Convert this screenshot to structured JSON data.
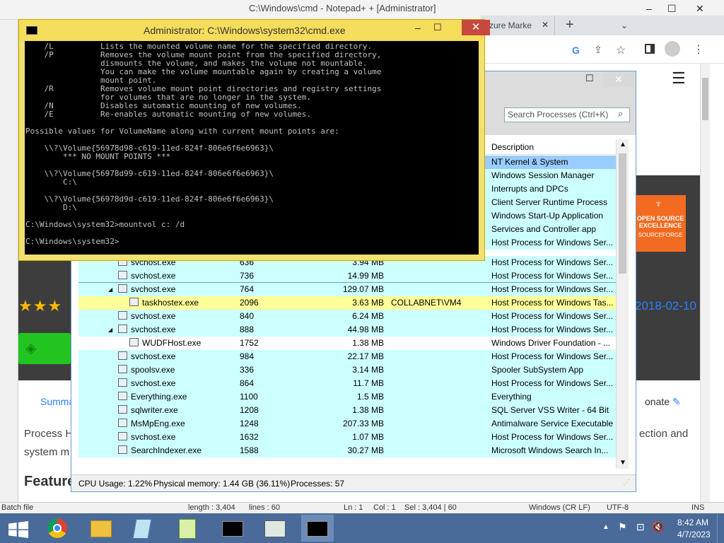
{
  "notepad": {
    "title_left": "C:\\Windows\\cmd",
    "title_mid": "- Notepad+ +",
    "title_right": "[Administrator]",
    "status": [
      "Batch file",
      "length : 3,404",
      "lines : 60",
      "Ln : 1",
      "Col : 1",
      "Sel : 3,404 | 60",
      "Windows (CR LF)",
      "UTF-8",
      "INS"
    ]
  },
  "chrome": {
    "tab_label": "Azure Marke",
    "new_tab": "+"
  },
  "webpage": {
    "badge_line1": "OPEN SOURCE",
    "badge_line2": "EXCELLENCE",
    "badge_brand": "SOURCEFORGE",
    "date": "2018-02-10",
    "stars": "★★★",
    "summary_tab": "Summa",
    "donate": "onate",
    "text_line1_left": "Process H",
    "text_line2_left": "system m",
    "text_line1_right": "ection and",
    "features_heading": "Feature"
  },
  "cmd": {
    "title": "Administrator: C:\\Windows\\system32\\cmd.exe",
    "output": "    /L          Lists the mounted volume name for the specified directory.\n    /P          Removes the volume mount point from the specified directory,\n                dismounts the volume, and makes the volume not mountable.\n                You can make the volume mountable again by creating a volume\n                mount point.\n    /R          Removes volume mount point directories and registry settings\n                for volumes that are no longer in the system.\n    /N          Disables automatic mounting of new volumes.\n    /E          Re-enables automatic mounting of new volumes.\n\nPossible values for VolumeName along with current mount points are:\n\n    \\\\?\\Volume{56978d98-c619-11ed-824f-806e6f6e6963}\\\n        *** NO MOUNT POINTS ***\n\n    \\\\?\\Volume{56978d99-c619-11ed-824f-806e6f6e6963}\\\n        C:\\\n\n    \\\\?\\Volume{56978d9d-c619-11ed-824f-806e6f6e6963}\\\n        D:\\\n\nC:\\Windows\\system32>mountvol c: /d\n\nC:\\Windows\\system32>"
  },
  "process_explorer": {
    "search_placeholder": "Search Processes (Ctrl+K)",
    "description_header": "Description",
    "top_descriptions": [
      "NT Kernel & System",
      "Windows Session Manager",
      "Interrupts and DPCs",
      "Client Server Runtime Process",
      "Windows Start-Up Application",
      "Services and Controller app",
      "Host Process for Windows Ser..."
    ],
    "rows": [
      {
        "name": "svchost.exe",
        "pid": "636",
        "mem": "3.94 MB",
        "user": "",
        "desc": "Host Process for Windows Ser...",
        "color": "#ccffff",
        "indent": 0,
        "expand": ""
      },
      {
        "name": "svchost.exe",
        "pid": "736",
        "mem": "14.99 MB",
        "user": "",
        "desc": "Host Process for Windows Ser...",
        "color": "#ccffff",
        "indent": 0,
        "expand": ""
      },
      {
        "name": "svchost.exe",
        "pid": "764",
        "mem": "129.07 MB",
        "user": "",
        "desc": "Host Process for Windows Ser...",
        "color": "#ccffff",
        "indent": 0,
        "expand": "◢",
        "selected": true
      },
      {
        "name": "taskhostex.exe",
        "pid": "2096",
        "mem": "3.63 MB",
        "user": "COLLABNET\\VM4",
        "desc": "Host Process for Windows Tas...",
        "color": "#ffff99",
        "indent": 1,
        "expand": ""
      },
      {
        "name": "svchost.exe",
        "pid": "840",
        "mem": "6.24 MB",
        "user": "",
        "desc": "Host Process for Windows Ser...",
        "color": "#ccffff",
        "indent": 0,
        "expand": ""
      },
      {
        "name": "svchost.exe",
        "pid": "888",
        "mem": "44.98 MB",
        "user": "",
        "desc": "Host Process for Windows Ser...",
        "color": "#ccffff",
        "indent": 0,
        "expand": "◢"
      },
      {
        "name": "WUDFHost.exe",
        "pid": "1752",
        "mem": "1.38 MB",
        "user": "",
        "desc": "Windows Driver Foundation - ...",
        "color": "#ffffff",
        "indent": 1,
        "expand": ""
      },
      {
        "name": "svchost.exe",
        "pid": "984",
        "mem": "22.17 MB",
        "user": "",
        "desc": "Host Process for Windows Ser...",
        "color": "#ccffff",
        "indent": 0,
        "expand": ""
      },
      {
        "name": "spoolsv.exe",
        "pid": "336",
        "mem": "3.14 MB",
        "user": "",
        "desc": "Spooler SubSystem App",
        "color": "#ccffff",
        "indent": 0,
        "expand": ""
      },
      {
        "name": "svchost.exe",
        "pid": "864",
        "mem": "11.7 MB",
        "user": "",
        "desc": "Host Process for Windows Ser...",
        "color": "#ccffff",
        "indent": 0,
        "expand": ""
      },
      {
        "name": "Everything.exe",
        "pid": "1100",
        "mem": "1.5 MB",
        "user": "",
        "desc": "Everything",
        "color": "#ccffff",
        "indent": 0,
        "expand": ""
      },
      {
        "name": "sqlwriter.exe",
        "pid": "1208",
        "mem": "1.38 MB",
        "user": "",
        "desc": "SQL Server VSS Writer - 64 Bit",
        "color": "#ccffff",
        "indent": 0,
        "expand": ""
      },
      {
        "name": "MsMpEng.exe",
        "pid": "1248",
        "mem": "207.33 MB",
        "user": "",
        "desc": "Antimalware Service Executable",
        "color": "#ccffff",
        "indent": 0,
        "expand": ""
      },
      {
        "name": "svchost.exe",
        "pid": "1632",
        "mem": "1.07 MB",
        "user": "",
        "desc": "Host Process for Windows Ser...",
        "color": "#ccffff",
        "indent": 0,
        "expand": ""
      },
      {
        "name": "SearchIndexer.exe",
        "pid": "1588",
        "mem": "30.27 MB",
        "user": "",
        "desc": "Microsoft Windows Search In...",
        "color": "#ccffff",
        "indent": 0,
        "expand": ""
      }
    ],
    "status": {
      "cpu": "CPU Usage: 1.22%",
      "memory": "Physical memory: 1.44 GB (36.11%)",
      "processes": "Processes: 57"
    }
  },
  "taskbar": {
    "time": "8:42 AM",
    "date": "4/7/2023"
  },
  "colors": {
    "accent_blue": "#1a73e8",
    "selected_row": "#99ccff",
    "service_row": "#ccffff",
    "own_row": "#ffff99"
  }
}
